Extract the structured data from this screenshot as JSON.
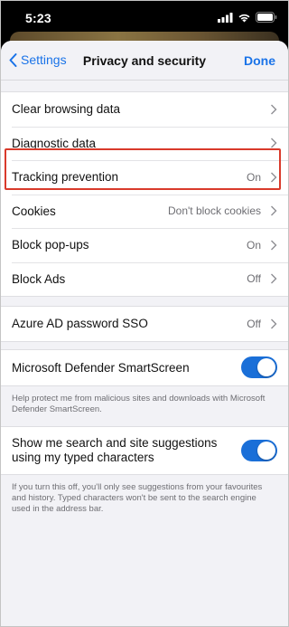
{
  "status_bar": {
    "time": "5:23",
    "icons": [
      "signal-icon",
      "wifi-icon",
      "battery-icon"
    ]
  },
  "nav": {
    "back_label": "Settings",
    "title": "Privacy and security",
    "done_label": "Done"
  },
  "group1": [
    {
      "label": "Clear browsing data",
      "value": ""
    },
    {
      "label": "Diagnostic data",
      "value": ""
    },
    {
      "label": "Tracking prevention",
      "value": "On"
    },
    {
      "label": "Cookies",
      "value": "Don't block cookies"
    },
    {
      "label": "Block pop-ups",
      "value": "On"
    },
    {
      "label": "Block Ads",
      "value": "Off"
    }
  ],
  "group2": {
    "azure": {
      "label": "Azure AD password SSO",
      "value": "Off"
    }
  },
  "group3": {
    "smartscreen": {
      "label": "Microsoft Defender SmartScreen",
      "enabled": true
    },
    "smartscreen_note": "Help protect me from malicious sites and downloads with Microsoft Defender SmartScreen."
  },
  "group4": {
    "suggestions": {
      "label_line1": "Show me search and site suggestions",
      "label_line2": "using my typed characters",
      "enabled": true
    },
    "suggestions_note": "If you turn this off, you'll only see suggestions from your favourites and history. Typed characters won't be sent to the search engine used in the address bar."
  },
  "colors": {
    "accent": "#1a73e8",
    "toggle_on": "#1a6fd8",
    "highlight": "#d93a2b"
  }
}
